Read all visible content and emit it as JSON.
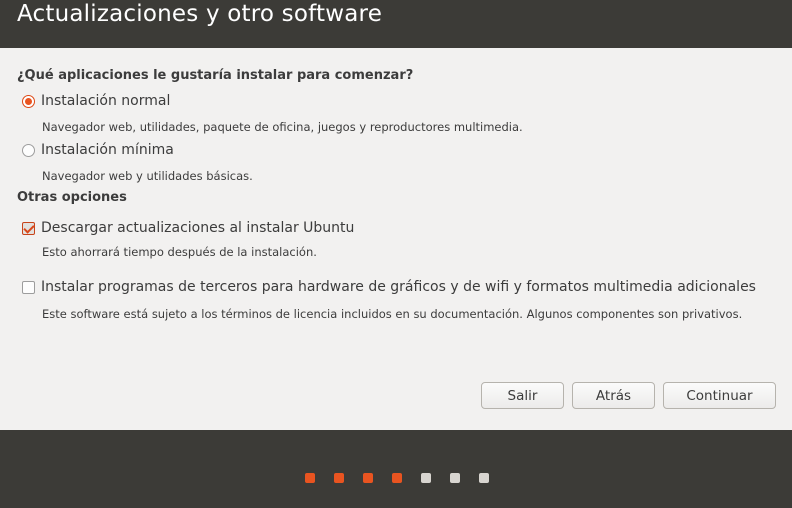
{
  "window": {
    "title": "Actualizaciones y otro software"
  },
  "install_question": {
    "heading": "¿Qué aplicaciones le gustaría instalar para comenzar?",
    "options": [
      {
        "label": "Instalación normal",
        "description": "Navegador web, utilidades, paquete de oficina, juegos y reproductores multimedia.",
        "selected": true
      },
      {
        "label": "Instalación mínima",
        "description": "Navegador web y utilidades básicas.",
        "selected": false
      }
    ]
  },
  "other_options": {
    "heading": "Otras opciones",
    "items": [
      {
        "label": "Descargar actualizaciones al instalar Ubuntu",
        "description": "Esto ahorrará tiempo después de la instalación.",
        "checked": true
      },
      {
        "label": "Instalar programas de terceros para hardware de gráficos y de wifi y formatos multimedia adicionales",
        "description": "Este software está sujeto a los términos de licencia incluidos en su documentación. Algunos componentes son privativos.",
        "checked": false
      }
    ]
  },
  "buttons": {
    "quit": "Salir",
    "back": "Atrás",
    "continue": "Continuar"
  },
  "progress": {
    "current_step": 4,
    "total_steps": 7
  },
  "colors": {
    "accent": "#e95420",
    "titlebar": "#3c3b37",
    "background": "#f2f1f0"
  }
}
